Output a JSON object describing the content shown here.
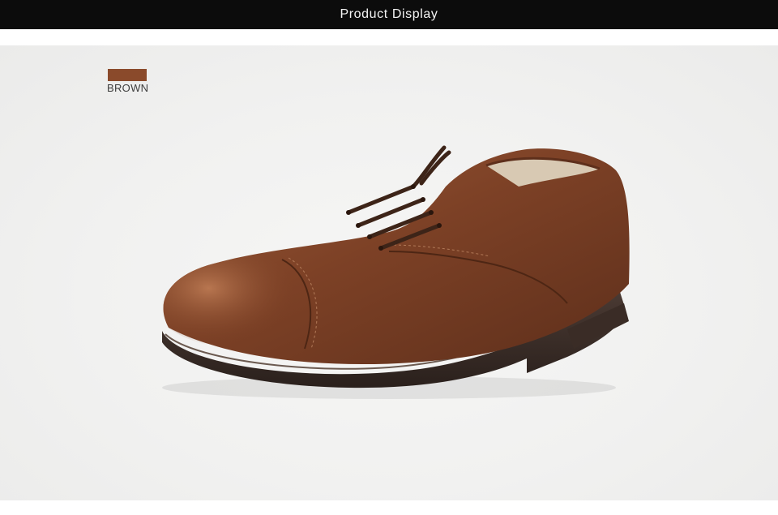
{
  "header": {
    "title": "Product Display"
  },
  "product": {
    "color_swatch": {
      "label": "BROWN",
      "color": "#8a4a2b"
    },
    "image": {
      "icon": "brown-leather-oxford-shoe-image"
    }
  },
  "colors": {
    "header_bg": "#0c0c0c",
    "stage_bg": "#f0f0ef"
  }
}
